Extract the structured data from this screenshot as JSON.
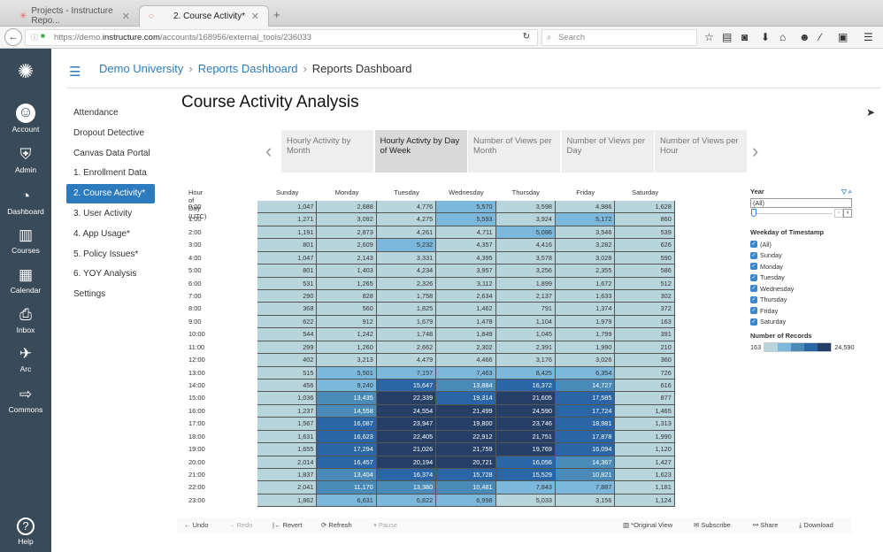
{
  "browser": {
    "tabs": [
      {
        "label": "Projects - Instructure Repo..."
      },
      {
        "label": "2. Course Activity*"
      }
    ],
    "url_prefix": "https://demo.",
    "url_domain": "instructure.com",
    "url_path": "/accounts/168956/external_tools/236033",
    "search_placeholder": "Search"
  },
  "global_nav": {
    "items": [
      {
        "label": "Account",
        "icon": "account-icon"
      },
      {
        "label": "Admin",
        "icon": "admin-icon"
      },
      {
        "label": "Dashboard",
        "icon": "dashboard-icon"
      },
      {
        "label": "Courses",
        "icon": "courses-icon"
      },
      {
        "label": "Calendar",
        "icon": "calendar-icon"
      },
      {
        "label": "Inbox",
        "icon": "inbox-icon"
      },
      {
        "label": "Arc",
        "icon": "arc-icon"
      },
      {
        "label": "Commons",
        "icon": "commons-icon"
      }
    ],
    "help": "Help"
  },
  "breadcrumb": [
    "Demo University",
    "Reports Dashboard",
    "Reports Dashboard"
  ],
  "menu": [
    "Attendance",
    "Dropout Detective",
    "Canvas Data Portal",
    "1. Enrollment Data",
    "2. Course Activity*",
    "3. User Activity",
    "4. App Usage*",
    "5. Policy Issues*",
    "6. YOY Analysis",
    "Settings"
  ],
  "menu_active": 4,
  "page_title": "Course Activity Analysis",
  "view_tabs": [
    "Hourly Activity by Month",
    "Hourly Activty by Day of Week",
    "Number of Views per Month",
    "Number of Views per Day",
    "Number of Views per Hour"
  ],
  "view_tab_active": 1,
  "chart_data": {
    "type": "heatmap",
    "row_header": "Hour of Day (UTC)",
    "columns": [
      "Sunday",
      "Monday",
      "Tuesday",
      "Wednesday",
      "Thursday",
      "Friday",
      "Saturday"
    ],
    "rows": [
      "0:00",
      "1:00",
      "2:00",
      "3:00",
      "4:00",
      "5:00",
      "6:00",
      "7:00",
      "8:00",
      "9:00",
      "10:00",
      "11:00",
      "12:00",
      "13:00",
      "14:00",
      "15:00",
      "16:00",
      "17:00",
      "18:00",
      "19:00",
      "20:00",
      "21:00",
      "22:00",
      "23:00"
    ],
    "values": [
      [
        1047,
        2688,
        4776,
        5570,
        3598,
        4986,
        1628
      ],
      [
        1271,
        3092,
        4275,
        5593,
        3924,
        5172,
        860
      ],
      [
        1191,
        2873,
        4261,
        4711,
        5086,
        3546,
        539
      ],
      [
        801,
        2609,
        5232,
        4357,
        4416,
        3282,
        626
      ],
      [
        1047,
        2143,
        3331,
        4395,
        3578,
        3028,
        590
      ],
      [
        801,
        1403,
        4234,
        3957,
        3256,
        2355,
        586
      ],
      [
        531,
        1265,
        2326,
        3112,
        1899,
        1672,
        512
      ],
      [
        290,
        828,
        1758,
        2634,
        2137,
        1633,
        302
      ],
      [
        368,
        560,
        1825,
        1462,
        791,
        1374,
        372
      ],
      [
        622,
        912,
        1679,
        1478,
        1104,
        1979,
        163
      ],
      [
        544,
        1242,
        1748,
        1849,
        1045,
        1799,
        391
      ],
      [
        299,
        1260,
        2662,
        2302,
        2391,
        1990,
        210
      ],
      [
        402,
        3213,
        4479,
        4466,
        3176,
        3026,
        360
      ],
      [
        515,
        5501,
        7157,
        7463,
        8425,
        6354,
        726
      ],
      [
        456,
        9240,
        15647,
        13884,
        16372,
        14727,
        616
      ],
      [
        1036,
        13435,
        22339,
        19314,
        21605,
        17585,
        877
      ],
      [
        1237,
        14558,
        24554,
        21499,
        24590,
        17724,
        1465
      ],
      [
        1567,
        16087,
        23947,
        19800,
        23746,
        18981,
        1313
      ],
      [
        1631,
        16623,
        22405,
        22912,
        21751,
        17878,
        1990
      ],
      [
        1655,
        17294,
        21026,
        21759,
        19769,
        16094,
        1120
      ],
      [
        2014,
        16457,
        20194,
        20721,
        16056,
        14367,
        1427
      ],
      [
        1837,
        13404,
        16374,
        15728,
        15529,
        10821,
        1623
      ],
      [
        2041,
        11170,
        13380,
        10481,
        7843,
        7887,
        1181
      ],
      [
        1862,
        6631,
        6822,
        6998,
        5033,
        3156,
        1124
      ]
    ],
    "color_range": [
      163,
      24590
    ],
    "color_steps": [
      "#b9d5dc",
      "#7cb8dc",
      "#4a8ab9",
      "#2a66a6",
      "#253f66"
    ]
  },
  "filters": {
    "year_label": "Year",
    "year_value": "(All)",
    "weekday_label": "Weekday of Timestamp",
    "weekday_options": [
      "(All)",
      "Sunday",
      "Monday",
      "Tuesday",
      "Wednesday",
      "Thursday",
      "Friday",
      "Saturday"
    ],
    "legend_label": "Number of Records",
    "legend_min": "163",
    "legend_max": "24,590"
  },
  "toolbar": {
    "undo": "Undo",
    "redo": "Redo",
    "revert": "Revert",
    "refresh": "Refresh",
    "pause": "Pause",
    "original_view": "*Original View",
    "subscribe": "Subscribe",
    "share": "Share",
    "download": "Download"
  }
}
